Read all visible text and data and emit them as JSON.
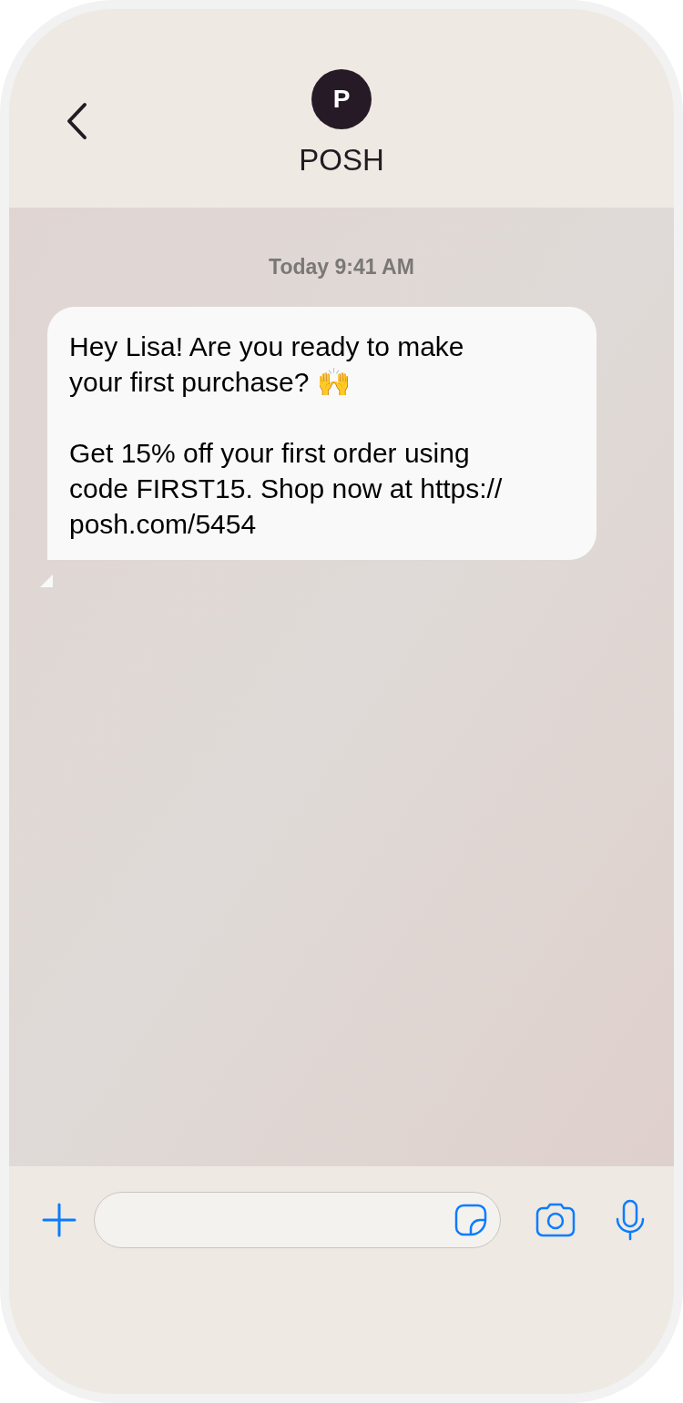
{
  "header": {
    "avatar_letter": "P",
    "contact_name": "POSH"
  },
  "conversation": {
    "timestamp": "Today 9:41 AM",
    "messages": [
      {
        "text": "Hey Lisa! Are you ready to make\nyour first purchase? 🙌\n\nGet 15% off your first order using\ncode FIRST15. Shop now at https://\nposh.com/5454"
      }
    ]
  }
}
